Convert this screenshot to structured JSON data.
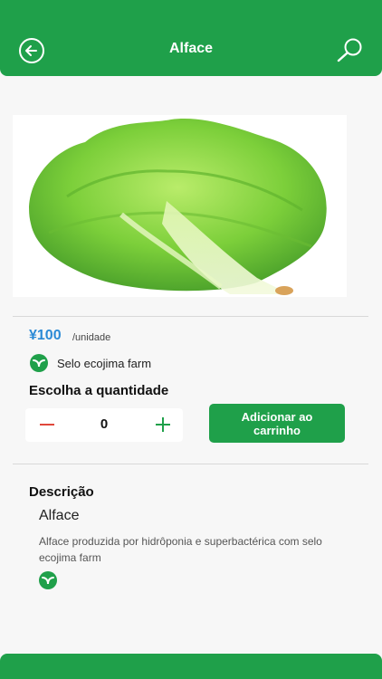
{
  "header": {
    "title": "Alface",
    "back_icon": "back-arrow-circle-icon",
    "search_icon": "search-icon"
  },
  "product": {
    "image": "lettuce-image",
    "price": "¥100",
    "unit": "/unidade",
    "seal_label": "Selo ecojima farm",
    "seal_icon": "ecojima-seal-icon"
  },
  "quantity": {
    "title": "Escolha a quantidade",
    "value": "0",
    "minus_icon": "minus-icon",
    "plus_icon": "plus-icon"
  },
  "cart_button": {
    "line1": "Adicionar ao",
    "line2": "carrinho"
  },
  "description": {
    "title": "Descrição",
    "name": "Alface",
    "text": "Alface produzida por hidrôponia e superbactérica com selo ecojima farm",
    "seal_icon": "ecojima-seal-icon"
  },
  "colors": {
    "brand_green": "#1fa04a",
    "price_blue": "#2b8ad6",
    "minus_red": "#e0473b",
    "plus_green": "#1fa04a"
  }
}
